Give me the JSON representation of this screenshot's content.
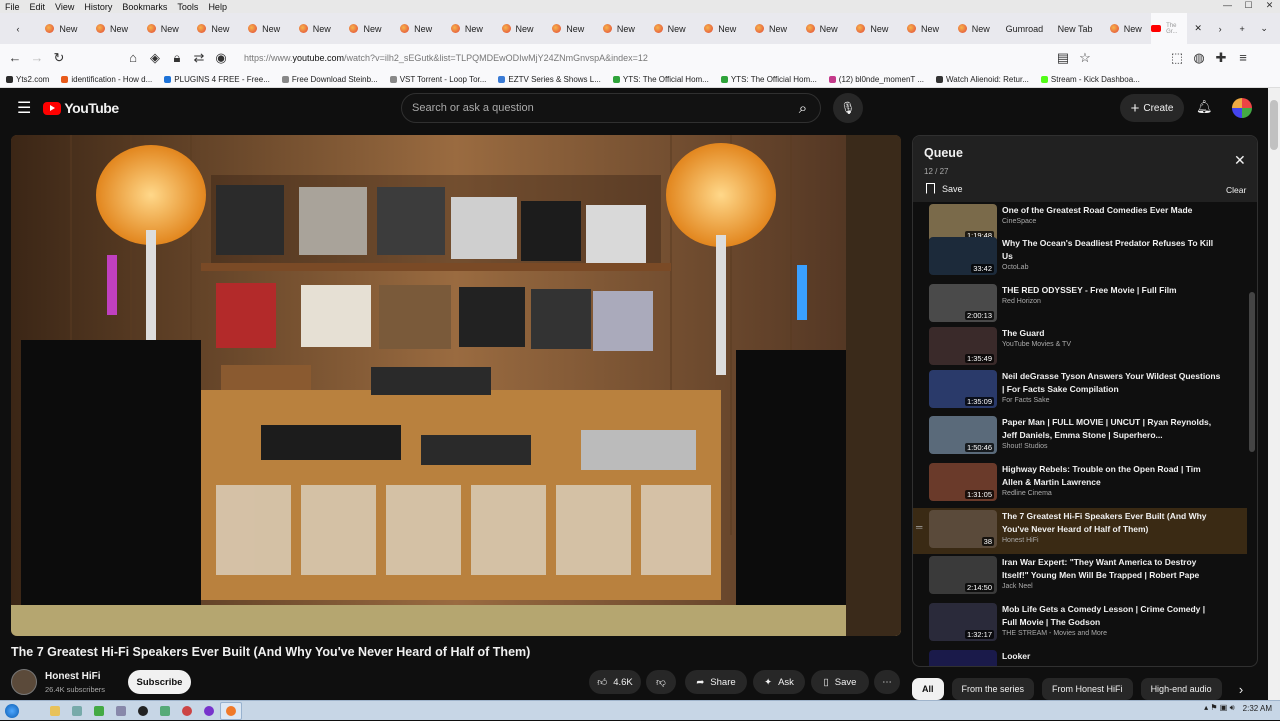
{
  "browser": {
    "menu": [
      "File",
      "Edit",
      "View",
      "History",
      "Bookmarks",
      "Tools",
      "Help"
    ],
    "tabs": [
      {
        "label": "New"
      },
      {
        "label": "New"
      },
      {
        "label": "New"
      },
      {
        "label": "New"
      },
      {
        "label": "New"
      },
      {
        "label": "New"
      },
      {
        "label": "New"
      },
      {
        "label": "New"
      },
      {
        "label": "New"
      },
      {
        "label": "New"
      },
      {
        "label": "New"
      },
      {
        "label": "New"
      },
      {
        "label": "New"
      },
      {
        "label": "New"
      },
      {
        "label": "New"
      },
      {
        "label": "New"
      },
      {
        "label": "New"
      },
      {
        "label": "New"
      },
      {
        "label": "New"
      },
      {
        "label": "Gumroad"
      },
      {
        "label": "New Tab"
      },
      {
        "label": "New"
      }
    ],
    "active_tab_label": "The Gr...",
    "url_prefix": "https://www.",
    "url_domain": "youtube.com",
    "url_rest": "/watch?v=ilh2_sEGutk&list=TLPQMDEwODIwMjY24ZNmGnvspA&index=12",
    "bookmarks": [
      {
        "label": "Yts2.com",
        "color": "#2b2b2b"
      },
      {
        "label": "identification - How d...",
        "color": "#e85a1a"
      },
      {
        "label": "PLUGINS 4 FREE - Free...",
        "color": "#1e73d8"
      },
      {
        "label": "Free Download Steinb...",
        "color": "#888888"
      },
      {
        "label": "VST Torrent - Loop Tor...",
        "color": "#888888"
      },
      {
        "label": "EZTV Series & Shows L...",
        "color": "#3a7bd5"
      },
      {
        "label": "YTS: The Official Hom...",
        "color": "#2fa33a"
      },
      {
        "label": "YTS: The Official Hom...",
        "color": "#2fa33a"
      },
      {
        "label": "(12) bl0nde_momenT ...",
        "color": "#c43a8a"
      },
      {
        "label": "Watch Alienoid: Retur...",
        "color": "#333333"
      },
      {
        "label": "Stream - Kick Dashboa...",
        "color": "#53fc18"
      }
    ]
  },
  "youtube": {
    "logo_text": "YouTube",
    "search_placeholder": "Search or ask a question",
    "create_label": "Create",
    "video": {
      "title": "The 7 Greatest Hi-Fi Speakers Ever Built (And Why You've Never Heard of Half of Them)",
      "channel": "Honest HiFi",
      "subscribers": "26.4K subscribers",
      "subscribe_label": "Subscribe",
      "likes": "4.6K",
      "share_label": "Share",
      "ask_label": "Ask",
      "save_label": "Save"
    },
    "queue": {
      "title": "Queue",
      "position": "12 / 27",
      "save_label": "Save",
      "clear_label": "Clear",
      "items": [
        {
          "title": "One of the Greatest Road Comedies Ever Made",
          "channel": "CineSpace",
          "duration": "1:19:48",
          "thumb": "#7a6a4a"
        },
        {
          "title": "Why The Ocean's Deadliest Predator Refuses To Kill Us",
          "channel": "OctoLab",
          "duration": "33:42",
          "thumb": "#1c2a3a"
        },
        {
          "title": "THE RED ODYSSEY - Free Movie | Full Film",
          "channel": "Red Horizon",
          "duration": "2:00:13",
          "thumb": "#4a4a4a"
        },
        {
          "title": "The Guard",
          "channel": "YouTube Movies & TV",
          "duration": "1:35:49",
          "thumb": "#3a2a2a"
        },
        {
          "title": "Neil deGrasse Tyson Answers Your Wildest Questions | For Facts Sake Compilation",
          "channel": "For Facts Sake",
          "duration": "1:35:09",
          "thumb": "#2a3a6a"
        },
        {
          "title": "Paper Man | FULL MOVIE | UNCUT | Ryan Reynolds, Jeff Daniels, Emma Stone | Superhero...",
          "channel": "Shout! Studios",
          "duration": "1:50:46",
          "thumb": "#5a6a7a"
        },
        {
          "title": "Highway Rebels: Trouble on the Open Road | Tim Allen & Martin Lawrence",
          "channel": "Redline Cinema",
          "duration": "1:31:05",
          "thumb": "#6a3a2a"
        },
        {
          "title": "The 7 Greatest Hi-Fi Speakers Ever Built (And Why You've Never Heard of Half of Them)",
          "channel": "Honest HiFi",
          "duration": "38",
          "thumb": "#5a4a3a",
          "current": true
        },
        {
          "title": "Iran War Expert: \"They Want America to Destroy Itself!\" Young Men Will Be Trapped | Robert Pape",
          "channel": "Jack Neel",
          "duration": "2:14:50",
          "thumb": "#3a3a3a"
        },
        {
          "title": "Mob Life Gets a Comedy Lesson | Crime Comedy | Full Movie | The Godson",
          "channel": "THE STREAM - Movies and More",
          "duration": "1:32:17",
          "thumb": "#2a2a3a"
        },
        {
          "title": "Looker",
          "channel": "",
          "duration": "",
          "thumb": "#1a1a4a"
        }
      ]
    },
    "chips": [
      "All",
      "From the series",
      "From Honest HiFi",
      "High-end audio"
    ]
  },
  "taskbar": {
    "time": "2:32 AM"
  }
}
